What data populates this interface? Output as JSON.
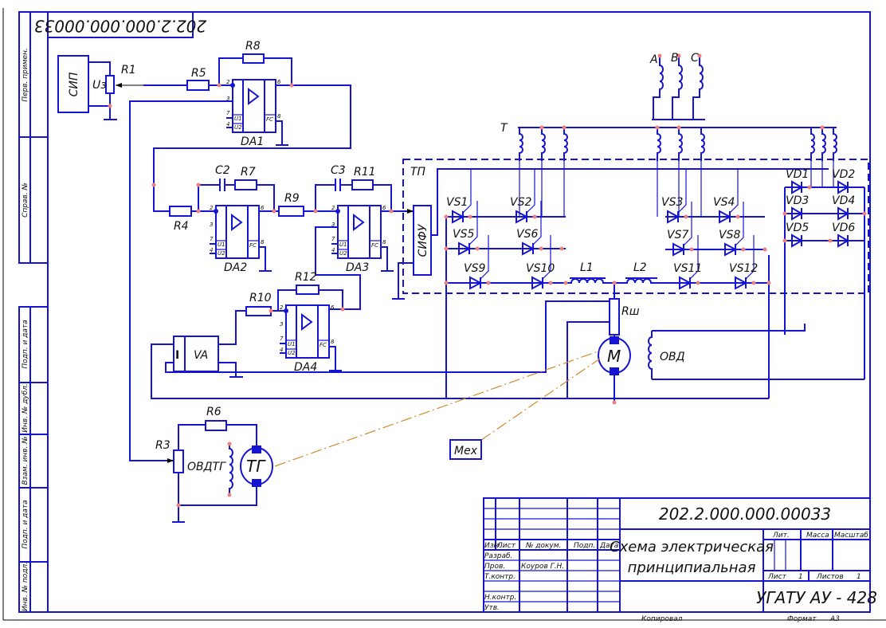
{
  "document": {
    "code": "202.2.000.000.00033",
    "code_rotated": "202.2.000.000.00033",
    "title_line1": "Схема электрическая",
    "title_line2": "принципиальная",
    "organization": "УГАТУ АУ - 428",
    "footer_copied": "Копировал",
    "footer_format": "Формат",
    "footer_format_value": "А3"
  },
  "title_block": {
    "headers": [
      "Изм.",
      "Лист",
      "№ докум.",
      "Подп.",
      "Дата"
    ],
    "roles": [
      "Разраб.",
      "Пров.",
      "Т.контр.",
      "",
      "Н.контр.",
      "Утв."
    ],
    "checker_name": "Коуров Г.Н.",
    "lit_label": "Лит.",
    "mass_label": "Масса",
    "scale_label": "Масштаб",
    "sheet_label": "Лист",
    "sheet_value": "1",
    "sheets_label": "Листов",
    "sheets_value": "1"
  },
  "side_strip": [
    "Перв. примен.",
    "Справ. №",
    "Подп. и дата",
    "Инв. № дубл.",
    "Взам. инв. №",
    "Подп. и дата",
    "Инв. № подл."
  ],
  "components": {
    "sip": "СИП",
    "uz": "Uз",
    "r1": "R1",
    "r3": "R3",
    "r4": "R4",
    "r5": "R5",
    "r6": "R6",
    "r7": "R7",
    "r8": "R8",
    "r9": "R9",
    "r10": "R10",
    "r11": "R11",
    "r12": "R12",
    "c2": "C2",
    "c3": "C3",
    "da1": "DA1",
    "da2": "DA2",
    "da3": "DA3",
    "da4": "DA4",
    "sifu": "СИФУ",
    "tp": "ТП",
    "t": "T",
    "phase_a": "A",
    "phase_b": "B",
    "phase_c": "C",
    "l1": "L1",
    "l2": "L2",
    "rsh": "Rш",
    "motor": "M",
    "ovd": "ОВД",
    "mex": "Мех",
    "tg": "ТГ",
    "ovdtg": "ОВДТГ",
    "va": "VA",
    "va_i": "I",
    "opamp_pins": {
      "p2": "2",
      "p3": "3",
      "p6": "6",
      "p7": "7",
      "p4": "4",
      "p8": "8",
      "u1": "U1",
      "u2": "U2",
      "fc": "FC"
    },
    "thyristors": [
      "VS1",
      "VS2",
      "VS3",
      "VS4",
      "VS5",
      "VS6",
      "VS7",
      "VS8",
      "VS9",
      "VS10",
      "VS11",
      "VS12"
    ],
    "diodes": [
      "VD1",
      "VD2",
      "VD3",
      "VD4",
      "VD5",
      "VD6"
    ]
  },
  "colors": {
    "wire": "#1414d2",
    "node": "#f08080",
    "mechanical_link": "#d08a2a"
  }
}
